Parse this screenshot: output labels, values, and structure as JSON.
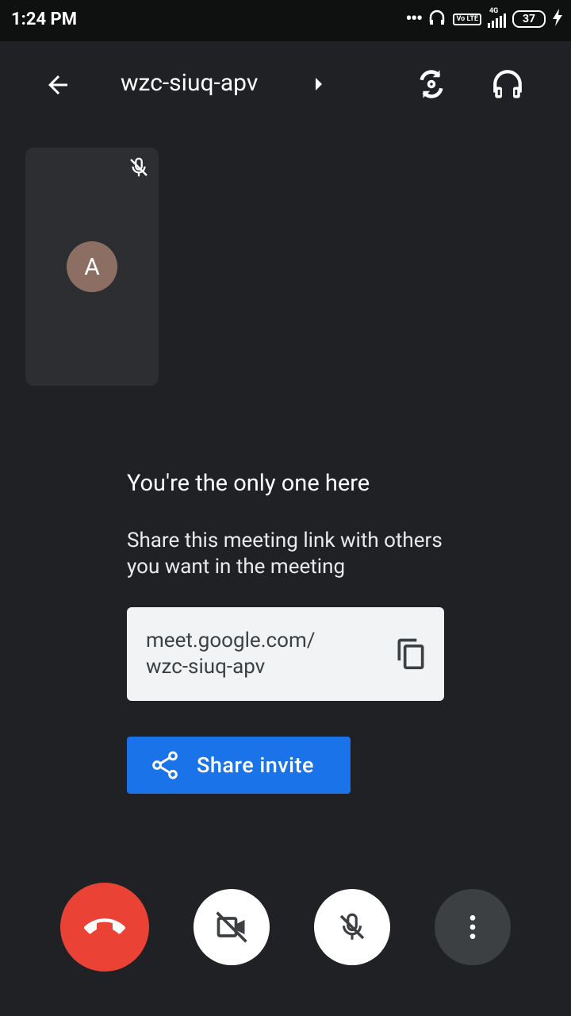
{
  "status_bar": {
    "time": "1:24 PM",
    "network": "4G",
    "volte": "Vo LTE",
    "battery": "37"
  },
  "header": {
    "meeting_code": "wzc-siuq-apv"
  },
  "participant": {
    "initial": "A"
  },
  "main": {
    "heading": "You're the only one here",
    "share_text": "Share this meeting link with others you want in the meeting",
    "link_line1": "meet.google.com/",
    "link_line2": "wzc-siuq-apv",
    "share_button_label": "Share invite"
  },
  "colors": {
    "background": "#202124",
    "end_call": "#ea4335",
    "share_button": "#1a73e8",
    "avatar": "#8d6e63"
  },
  "icons": [
    "back-arrow-icon",
    "chevron-right-icon",
    "switch-camera-icon",
    "headphones-icon",
    "mic-off-icon",
    "copy-icon",
    "share-icon",
    "end-call-icon",
    "video-off-icon",
    "more-vert-icon"
  ]
}
